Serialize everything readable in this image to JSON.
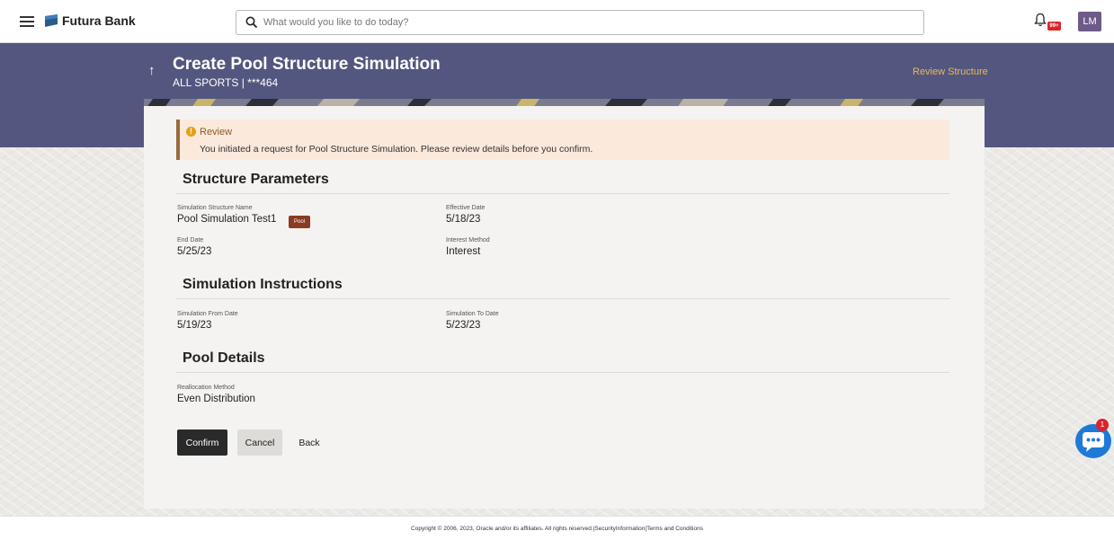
{
  "header": {
    "brand_name": "Futura Bank",
    "search_placeholder": "What would you like to do today?",
    "notification_count": "99+",
    "user_initials": "LM"
  },
  "banner": {
    "title": "Create Pool Structure Simulation",
    "subtitle": "ALL SPORTS | ***464",
    "review_link": "Review Structure"
  },
  "alert": {
    "title": "Review",
    "message": "You initiated a request for Pool Structure Simulation. Please review details before you confirm."
  },
  "structure_parameters": {
    "heading": "Structure Parameters",
    "simulation_structure_name_label": "Simulation Structure Name",
    "simulation_structure_name": "Pool Simulation Test1",
    "tag": "Pool",
    "effective_date_label": "Effective Date",
    "effective_date": "5/18/23",
    "end_date_label": "End Date",
    "end_date": "5/25/23",
    "interest_method_label": "Interest Method",
    "interest_method": "Interest"
  },
  "simulation_instructions": {
    "heading": "Simulation Instructions",
    "from_date_label": "Simulation From Date",
    "from_date": "5/19/23",
    "to_date_label": "Simulation To Date",
    "to_date": "5/23/23"
  },
  "pool_details": {
    "heading": "Pool Details",
    "reallocation_method_label": "Reallocation Method",
    "reallocation_method": "Even Distribution"
  },
  "actions": {
    "confirm": "Confirm",
    "cancel": "Cancel",
    "back": "Back"
  },
  "chat": {
    "badge_count": "1"
  },
  "footer": {
    "text": "Copyright © 2006, 2023, Oracle and/or its affiliates. All rights reserved.|SecurityInformation|Terms and Conditions"
  },
  "colors": {
    "banner": "#53577f",
    "accent_link": "#e9b65f",
    "alert_bg": "#fbe9dc",
    "pool_tag": "#8b3b1f",
    "primary_button": "#2a2a2a",
    "chat": "#1e7ad6",
    "badge": "#d9242b"
  },
  "icons": [
    "hamburger-icon",
    "bank-logo-icon",
    "search-icon",
    "bell-icon",
    "info-icon",
    "arrow-up-icon",
    "chat-icon"
  ]
}
